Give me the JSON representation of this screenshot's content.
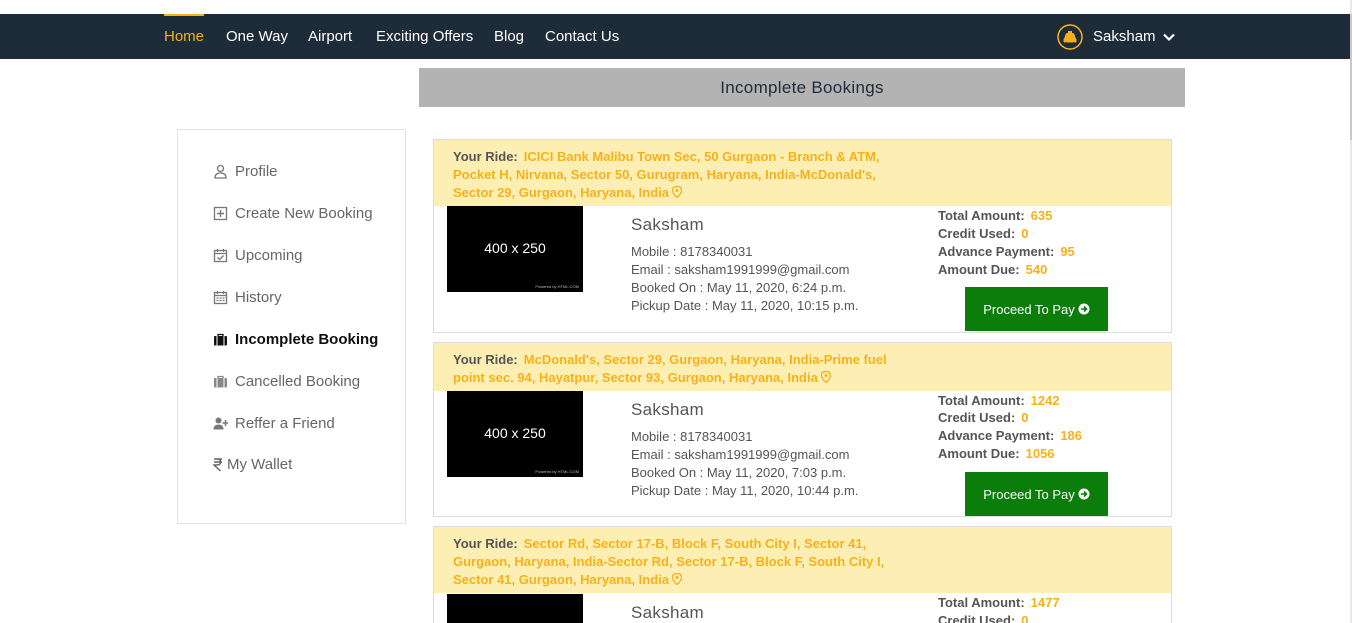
{
  "nav": {
    "items": [
      {
        "label": "Home",
        "active": true
      },
      {
        "label": "One Way"
      },
      {
        "label": "Airport"
      },
      {
        "label": "Exciting Offers"
      },
      {
        "label": "Blog"
      },
      {
        "label": "Contact Us"
      }
    ],
    "user": {
      "name": "Saksham",
      "avatar_icon": "taxi-avatar-icon",
      "dropdown_icon": "chevron-down-icon"
    }
  },
  "page_title": "Incomplete Bookings",
  "sidebar": {
    "items": [
      {
        "label": "Profile",
        "icon": "user-icon"
      },
      {
        "label": "Create New Booking",
        "icon": "plus-square-icon"
      },
      {
        "label": "Upcoming",
        "icon": "calendar-check-icon"
      },
      {
        "label": "History",
        "icon": "calendar-icon"
      },
      {
        "label": "Incomplete Booking",
        "icon": "briefcase-icon",
        "active": true
      },
      {
        "label": "Cancelled Booking",
        "icon": "briefcase-icon"
      },
      {
        "label": "Reffer a Friend",
        "icon": "user-plus-icon"
      },
      {
        "label": "My Wallet",
        "icon": "rupee-icon"
      }
    ]
  },
  "labels": {
    "your_ride": "Your Ride:",
    "mobile": "Mobile : ",
    "email": "Email : ",
    "booked_on": "Booked On : ",
    "pickup_date": "Pickup Date : ",
    "total_amount": "Total Amount:",
    "credit_used": "Credit Used:",
    "advance_payment": "Advance Payment:",
    "amount_due": "Amount Due:",
    "pay_button": "Proceed To Pay",
    "thumb_text": "400 x 250",
    "thumb_credit": "Powered by HTML.COM"
  },
  "bookings": [
    {
      "ride": "ICICI Bank Malibu Town Sec, 50 Gurgaon - Branch & ATM, Pocket H, Nirvana, Sector 50, Gurugram, Haryana, India-McDonald's, Sector 29, Gurgaon, Haryana, India",
      "name": "Saksham",
      "mobile": "8178340031",
      "email": "saksham1991999@gmail.com",
      "booked_on": "May 11, 2020, 6:24 p.m.",
      "pickup_date": "May 11, 2020, 10:15 p.m.",
      "total_amount": "635",
      "credit_used": "0",
      "advance_payment": "95",
      "amount_due": "540"
    },
    {
      "ride": "McDonald's, Sector 29, Gurgaon, Haryana, India-Prime fuel point sec. 94, Hayatpur, Sector 93, Gurgaon, Haryana, India",
      "name": "Saksham",
      "mobile": "8178340031",
      "email": "saksham1991999@gmail.com",
      "booked_on": "May 11, 2020, 7:03 p.m.",
      "pickup_date": "May 11, 2020, 10:44 p.m.",
      "total_amount": "1242",
      "credit_used": "0",
      "advance_payment": "186",
      "amount_due": "1056"
    },
    {
      "ride": "Sector Rd, Sector 17-B, Block F, South City I, Sector 41, Gurgaon, Haryana, India-Sector Rd, Sector 17-B, Block F, South City I, Sector 41, Gurgaon, Haryana, India",
      "name": "Saksham",
      "total_amount": "1477",
      "credit_used": "0"
    }
  ]
}
